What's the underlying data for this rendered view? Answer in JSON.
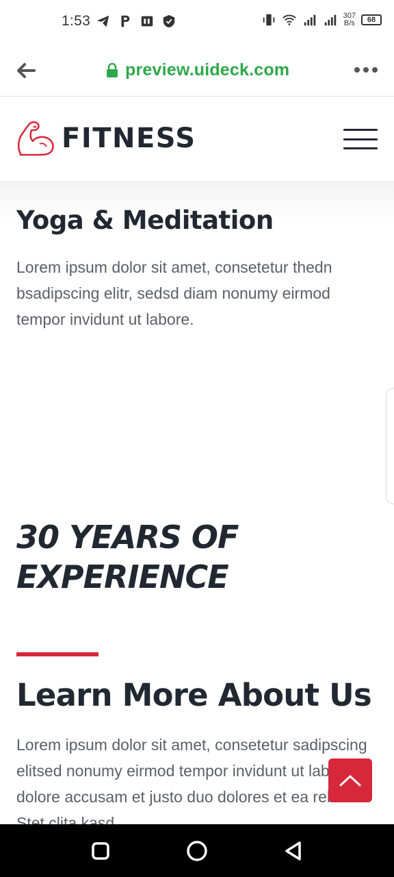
{
  "status_bar": {
    "time": "1:53",
    "net_speed_value": "307",
    "net_speed_unit": "B/s",
    "battery": "68"
  },
  "browser": {
    "url": "preview.uideck.com",
    "url_color": "#2ea84a"
  },
  "header": {
    "logo_text": "FITNESS",
    "accent_color": "#d7273b"
  },
  "yoga": {
    "title": "Yoga & Meditation",
    "text": "Lorem ipsum dolor sit amet, consetetur thedn bsadipscing elitr, sedsd diam nonumy eirmod tempor invidunt ut labore."
  },
  "experience": {
    "line1": "30 YEARS OF",
    "line2": "EXPERIENCE"
  },
  "about": {
    "title": "Learn More About Us",
    "text": "Lorem ipsum dolor sit amet, consetetur sadipscing elitsed nonumy eirmod tempor invidunt ut labore et dolore accusam et justo duo dolores et ea rebum. Stet clita kasd"
  },
  "icons": {
    "back": "back-arrow-icon",
    "lock": "lock-icon",
    "more": "more-dots-icon",
    "menu": "hamburger-menu-icon",
    "scroll_top": "chevron-up-icon"
  }
}
